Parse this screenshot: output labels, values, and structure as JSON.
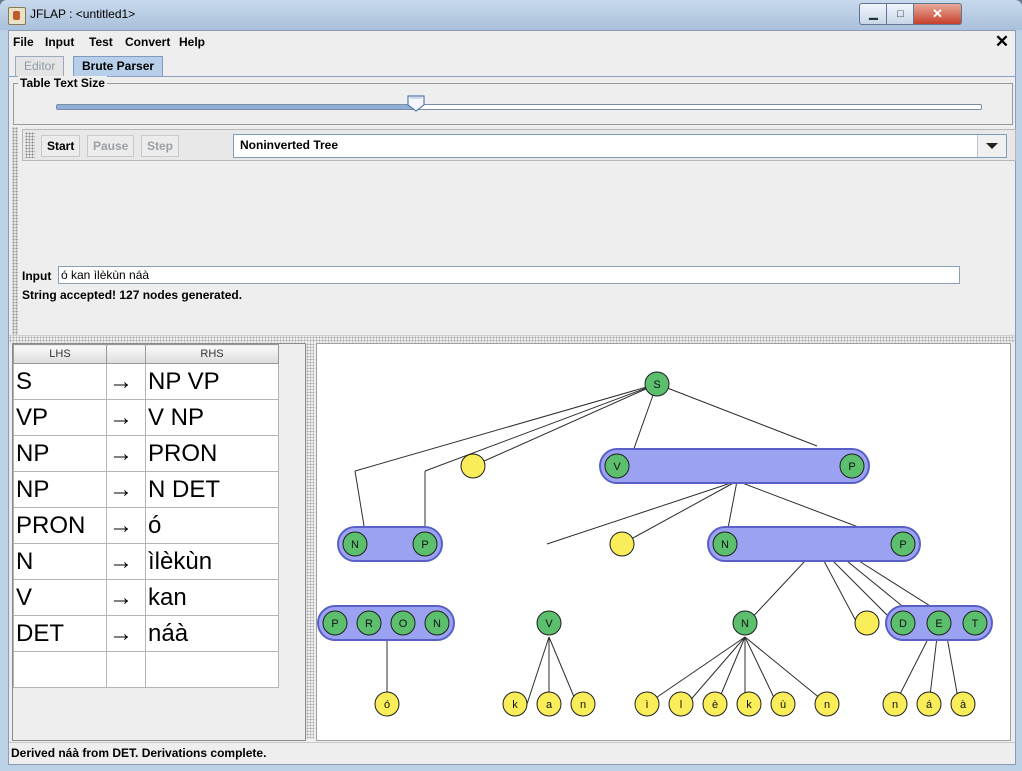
{
  "window": {
    "title": "JFLAP : <untitled1>"
  },
  "menu": {
    "items": [
      "File",
      "Input",
      "Test",
      "Convert",
      "Help"
    ],
    "close_glyph": "✕"
  },
  "tabs": [
    {
      "label": "Editor",
      "selected": false
    },
    {
      "label": "Brute Parser",
      "selected": true
    }
  ],
  "table_text_size": {
    "title": "Table Text Size",
    "slider_value": 0.39
  },
  "toolbar": {
    "start": "Start",
    "pause": "Pause",
    "step": "Step",
    "view_mode": "Noninverted Tree"
  },
  "input": {
    "label": "Input",
    "value": "ó kan ìlèkùn náà"
  },
  "result": "String accepted!  127 nodes generated.",
  "grammar": {
    "headers": {
      "lhs": "LHS",
      "arrow": "",
      "rhs": "RHS"
    },
    "rows": [
      {
        "lhs": "S",
        "arrow": "→",
        "rhs": "NP VP"
      },
      {
        "lhs": "VP",
        "arrow": "→",
        "rhs": "V NP"
      },
      {
        "lhs": "NP",
        "arrow": "→",
        "rhs": "PRON"
      },
      {
        "lhs": "NP",
        "arrow": "→",
        "rhs": "N DET"
      },
      {
        "lhs": "PRON",
        "arrow": "→",
        "rhs": "ó"
      },
      {
        "lhs": "N",
        "arrow": "→",
        "rhs": "ìlèkùn"
      },
      {
        "lhs": "V",
        "arrow": "→",
        "rhs": "kan"
      },
      {
        "lhs": "DET",
        "arrow": "→",
        "rhs": "náà"
      },
      {
        "lhs": "",
        "arrow": "",
        "rhs": ""
      }
    ]
  },
  "parse_tree": {
    "colors": {
      "nonterminal": "#5cbf6e",
      "terminal": "#f9ee5a",
      "group": "#9ca2f2",
      "group_border": "#5860c8",
      "edge": "#2d2d2d"
    },
    "nodes": {
      "S": "S",
      "VP": [
        "V",
        "P"
      ],
      "NP1": [
        "N",
        "P"
      ],
      "NP2": [
        "N",
        "P"
      ],
      "PRON": [
        "P",
        "R",
        "O",
        "N"
      ],
      "DET": [
        "D",
        "E",
        "T"
      ],
      "V": "V",
      "N": "N",
      "leaf_o": [
        "ó"
      ],
      "leaf_kan": [
        "k",
        "a",
        "n"
      ],
      "leaf_ileku": [
        "ì",
        "l",
        "è",
        "k",
        "ù",
        "n"
      ],
      "leaf_naa": [
        "n",
        "á",
        "à"
      ]
    }
  },
  "status": "Derived náà from DET.  Derivations complete."
}
